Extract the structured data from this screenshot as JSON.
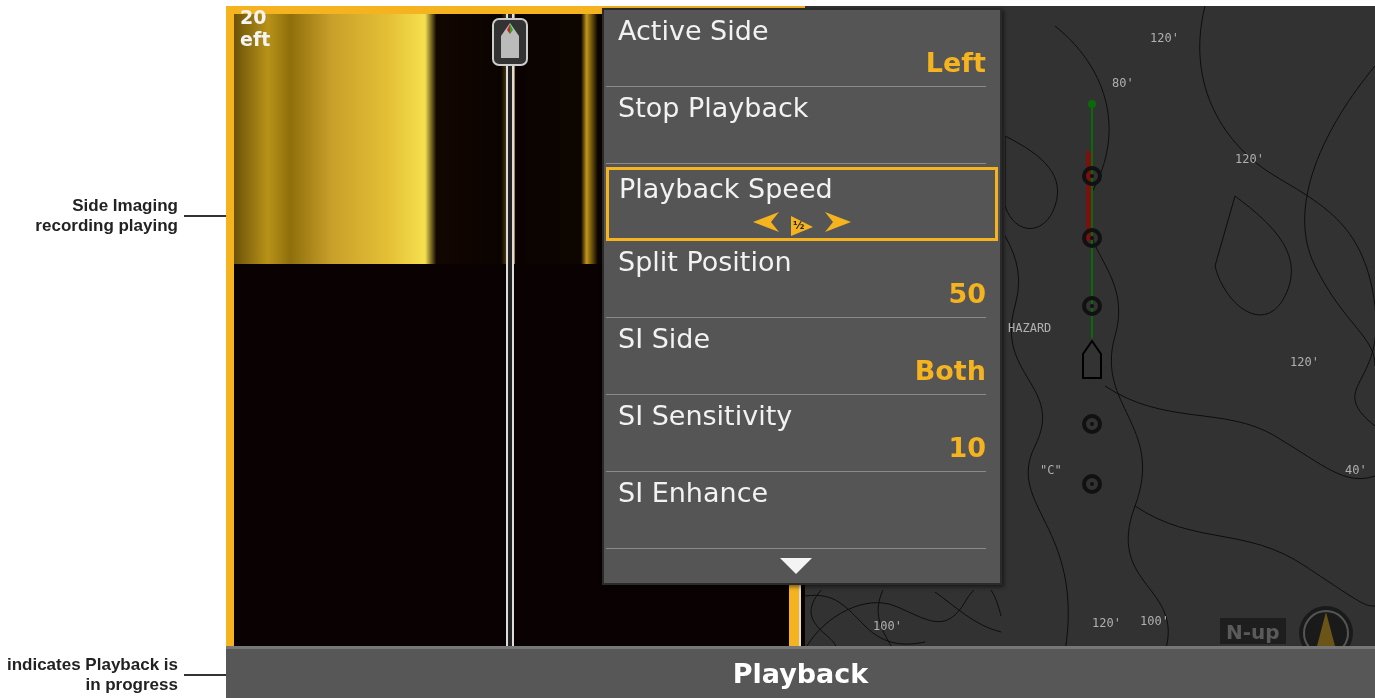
{
  "annotations": [
    {
      "text": "Side Imaging recording playing"
    },
    {
      "text": "indicates Playback is in progress"
    }
  ],
  "sonar": {
    "depth": "20",
    "side": "eft"
  },
  "menu": {
    "items": [
      {
        "kind": "value",
        "label": "Active Side",
        "value": "Left",
        "selected": false
      },
      {
        "kind": "plain",
        "label": "Stop Playback",
        "selected": false
      },
      {
        "kind": "speed",
        "label": "Playback Speed",
        "value": "½",
        "selected": true
      },
      {
        "kind": "value",
        "label": "Split Position",
        "value": "50",
        "selected": false
      },
      {
        "kind": "value",
        "label": "SI Side",
        "value": "Both",
        "selected": false
      },
      {
        "kind": "value",
        "label": "SI Sensitivity",
        "value": "10",
        "selected": false
      },
      {
        "kind": "plain",
        "label": "SI Enhance",
        "selected": false
      }
    ]
  },
  "map": {
    "labels": [
      "120'",
      "80'",
      "120'",
      "HAZARD",
      "120'",
      "\"C\"",
      "40'",
      "100'",
      "120'",
      "100'"
    ],
    "orientation": "N-up"
  },
  "status_bar": {
    "title": "Playback"
  }
}
